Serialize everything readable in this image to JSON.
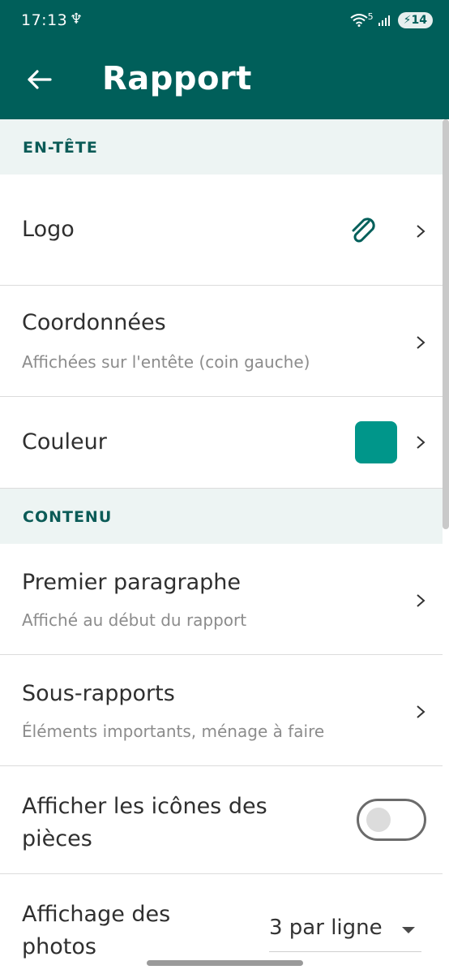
{
  "status": {
    "time": "17:13",
    "battery": "14",
    "network": "5"
  },
  "appbar": {
    "title": "Rapport"
  },
  "sections": {
    "header": {
      "label": "EN-TÊTE"
    },
    "content": {
      "label": "CONTENU"
    }
  },
  "rows": {
    "logo": {
      "title": "Logo"
    },
    "coordonnees": {
      "title": "Coordonnées",
      "subtitle": "Affichées sur l'entête (coin gauche)"
    },
    "couleur": {
      "title": "Couleur",
      "color": "#00968a"
    },
    "premier": {
      "title": "Premier paragraphe",
      "subtitle": "Affiché au début du rapport"
    },
    "sousrapports": {
      "title": "Sous-rapports",
      "subtitle": "Éléments importants, ménage à faire"
    },
    "icones": {
      "title": "Afficher les icônes des pièces",
      "enabled": false
    },
    "photos": {
      "title": "Affichage des photos",
      "value": "3 par ligne"
    }
  },
  "colors": {
    "primary": "#005f5a",
    "accent_swatch": "#00968a"
  }
}
